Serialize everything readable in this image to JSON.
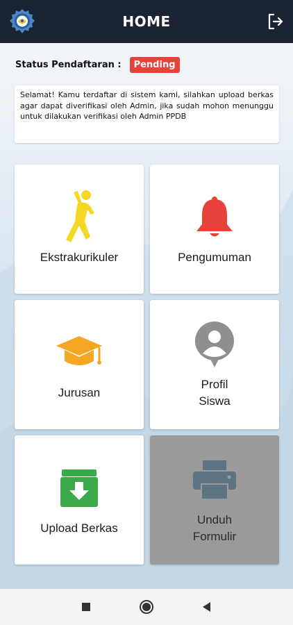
{
  "header": {
    "title": "HOME",
    "logo_icon": "school-emblem-icon",
    "logout_icon": "logout-icon"
  },
  "status": {
    "label": "Status Pendaftaran :",
    "value": "Pending",
    "badge_color": "#e8413a"
  },
  "notice": {
    "text": "Selamat! Kamu terdaftar di sistem kami, silahkan upload berkas agar dapat diverifikasi oleh Admin, jika sudah mohon menunggu untuk dilakukan verifikasi oleh Admin PPDB"
  },
  "menu": [
    {
      "label": "Ekstrakurikuler",
      "icon": "sport-figure-icon",
      "color": "#f5d824"
    },
    {
      "label": "Pengumuman",
      "icon": "bell-icon",
      "color": "#e8413a"
    },
    {
      "label": "Jurusan",
      "icon": "graduation-cap-icon",
      "color": "#f5a623"
    },
    {
      "label_line1": "Profil",
      "label_line2": "Siswa",
      "icon": "user-profile-icon",
      "color": "#8f8f8f"
    },
    {
      "label": "Upload Berkas",
      "icon": "archive-download-icon",
      "color": "#3aa94a"
    },
    {
      "label_line1": "Unduh",
      "label_line2": "Formulir",
      "icon": "printer-icon",
      "color": "#5c7382"
    }
  ],
  "theme": {
    "appbar_color": "#1b2433"
  },
  "navigation": {
    "recent_icon": "square-icon",
    "home_icon": "circle-home-icon",
    "back_icon": "back-triangle-icon"
  }
}
